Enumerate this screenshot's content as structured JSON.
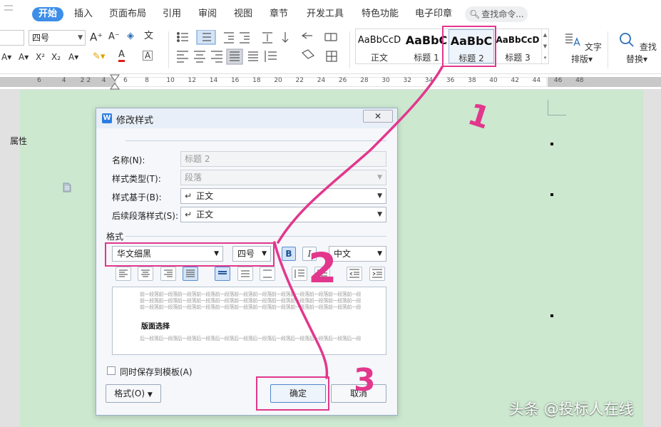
{
  "menu": {
    "tabs": [
      "开始",
      "插入",
      "页面布局",
      "引用",
      "审阅",
      "视图",
      "章节",
      "开发工具",
      "特色功能",
      "电子印章"
    ],
    "search_placeholder": "查找命令..."
  },
  "ribbon": {
    "font_size": "四号",
    "grow_font": "A⁺",
    "shrink_font": "A⁻",
    "pinyin": "文",
    "style_gallery": [
      {
        "preview": "AaBbCcD",
        "name": "正文"
      },
      {
        "preview": "AaBbC",
        "name": "标题 1"
      },
      {
        "preview": "AaBbC",
        "name": "标题 2"
      },
      {
        "preview": "AaBbCcD",
        "name": "标题 3"
      }
    ],
    "text_layout_label": "文字排版",
    "find_replace_label": "查找替换"
  },
  "ruler": {
    "ticks": [
      "6",
      "4",
      "2",
      "2",
      "4",
      "6",
      "8",
      "10",
      "12",
      "14",
      "16",
      "18",
      "20",
      "22",
      "24",
      "26",
      "28",
      "30",
      "32",
      "34",
      "36",
      "38",
      "40",
      "42",
      "44",
      "46",
      "48"
    ]
  },
  "dialog": {
    "title": "修改样式",
    "close_label": "✕",
    "properties_group": "属性",
    "name_label": "名称(N):",
    "name_value": "标题 2",
    "style_type_label": "样式类型(T):",
    "style_type_value": "段落",
    "based_on_label": "样式基于(B):",
    "based_on_value": "正文",
    "next_style_label": "后续段落样式(S):",
    "next_style_value": "正文",
    "format_group": "格式",
    "font_name": "华文细黑",
    "font_size": "四号",
    "bold_label": "B",
    "italic_label": "I",
    "script_value": "中文",
    "preview_prev_text": "前一段落前一段落前一段落前一段落前一段落前一段落前一段落前一段落前一段落前一段落前一段落前一段落",
    "preview_sample": "版面选择",
    "preview_next_text": "后一段落后一段落后一段落后一段落后一段落后一段落后一段落后一段落后一段落后一段落后一段落后一段落",
    "save_to_template_label": "同时保存到模板(A)",
    "format_button": "格式(O)",
    "ok_button": "确定",
    "cancel_button": "取消"
  },
  "annotations": {
    "step_1": "1",
    "step_2": "2",
    "step_3": "3",
    "highlight_color": "#e2378d"
  },
  "watermark": "头条 @投标人在线"
}
